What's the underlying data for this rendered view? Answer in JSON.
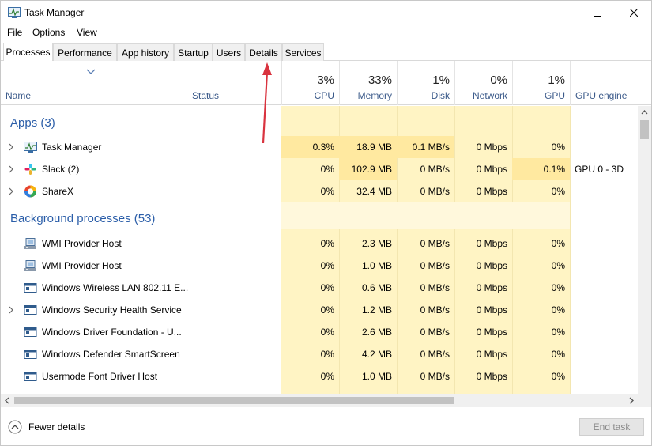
{
  "window": {
    "title": "Task Manager",
    "controls": {
      "minimize": "minimize-icon",
      "maximize": "maximize-icon",
      "close": "close-icon"
    }
  },
  "menu": [
    "File",
    "Options",
    "View"
  ],
  "tabs": [
    {
      "label": "Processes",
      "active": true
    },
    {
      "label": "Performance"
    },
    {
      "label": "App history"
    },
    {
      "label": "Startup"
    },
    {
      "label": "Users"
    },
    {
      "label": "Details"
    },
    {
      "label": "Services"
    }
  ],
  "columns": {
    "name": "Name",
    "status": "Status",
    "cpu": {
      "percent": "3%",
      "label": "CPU"
    },
    "memory": {
      "percent": "33%",
      "label": "Memory"
    },
    "disk": {
      "percent": "1%",
      "label": "Disk"
    },
    "network": {
      "percent": "0%",
      "label": "Network"
    },
    "gpu": {
      "percent": "1%",
      "label": "GPU"
    },
    "gpu_engine": "GPU engine"
  },
  "groups": {
    "apps": "Apps (3)",
    "background": "Background processes (53)"
  },
  "apps": [
    {
      "name": "Task Manager",
      "icon": "task-manager-icon",
      "cpu": "0.3%",
      "memory": "18.9 MB",
      "disk": "0.1 MB/s",
      "network": "0 Mbps",
      "gpu": "0%",
      "gpu_engine": ""
    },
    {
      "name": "Slack (2)",
      "icon": "slack-icon",
      "cpu": "0%",
      "memory": "102.9 MB",
      "disk": "0 MB/s",
      "network": "0 Mbps",
      "gpu": "0.1%",
      "gpu_engine": "GPU 0 - 3D"
    },
    {
      "name": "ShareX",
      "icon": "sharex-icon",
      "cpu": "0%",
      "memory": "32.4 MB",
      "disk": "0 MB/s",
      "network": "0 Mbps",
      "gpu": "0%",
      "gpu_engine": ""
    }
  ],
  "background": [
    {
      "name": "WMI Provider Host",
      "icon": "wmi-provider-icon",
      "expandable": false,
      "cpu": "0%",
      "memory": "2.3 MB",
      "disk": "0 MB/s",
      "network": "0 Mbps",
      "gpu": "0%"
    },
    {
      "name": "WMI Provider Host",
      "icon": "wmi-provider-icon",
      "expandable": false,
      "cpu": "0%",
      "memory": "1.0 MB",
      "disk": "0 MB/s",
      "network": "0 Mbps",
      "gpu": "0%"
    },
    {
      "name": "Windows Wireless LAN 802.11 E...",
      "icon": "service-window-icon",
      "expandable": false,
      "cpu": "0%",
      "memory": "0.6 MB",
      "disk": "0 MB/s",
      "network": "0 Mbps",
      "gpu": "0%"
    },
    {
      "name": "Windows Security Health Service",
      "icon": "service-window-icon",
      "expandable": true,
      "cpu": "0%",
      "memory": "1.2 MB",
      "disk": "0 MB/s",
      "network": "0 Mbps",
      "gpu": "0%"
    },
    {
      "name": "Windows Driver Foundation - U...",
      "icon": "service-window-icon",
      "expandable": false,
      "cpu": "0%",
      "memory": "2.6 MB",
      "disk": "0 MB/s",
      "network": "0 Mbps",
      "gpu": "0%"
    },
    {
      "name": "Windows Defender SmartScreen",
      "icon": "service-window-icon",
      "expandable": false,
      "cpu": "0%",
      "memory": "4.2 MB",
      "disk": "0 MB/s",
      "network": "0 Mbps",
      "gpu": "0%"
    },
    {
      "name": "Usermode Font Driver Host",
      "icon": "service-window-icon",
      "expandable": false,
      "cpu": "0%",
      "memory": "1.0 MB",
      "disk": "0 MB/s",
      "network": "0 Mbps",
      "gpu": "0%"
    }
  ],
  "footer": {
    "fewer_details": "Fewer details",
    "end_task": "End task"
  },
  "colors": {
    "heat_light": "#fff4c4",
    "heat_medium": "#ffefb0",
    "group_title": "#2a5da8",
    "annotation_arrow": "#d9333f"
  }
}
